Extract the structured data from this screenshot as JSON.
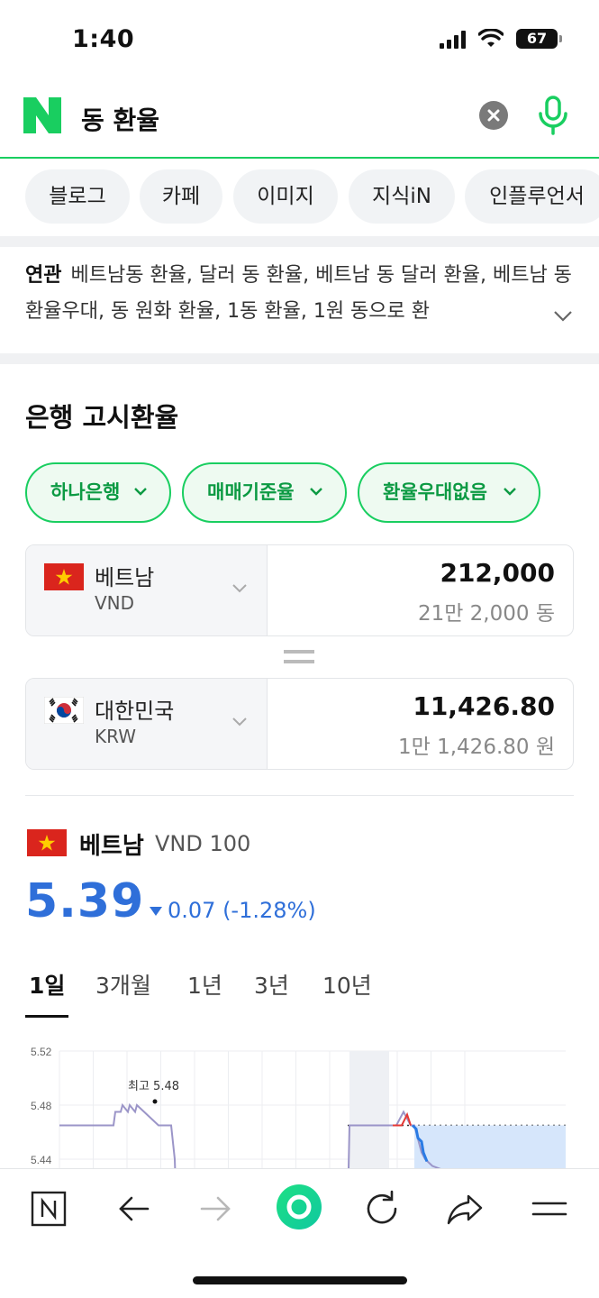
{
  "status": {
    "time": "1:40",
    "battery": "67"
  },
  "search": {
    "query": "동 환율"
  },
  "tabs": [
    "블로그",
    "카페",
    "이미지",
    "지식iN",
    "인플루언서"
  ],
  "related": {
    "label": "연관",
    "text": "베트남동 환율, 달러 동 환율, 베트남 동 달러 환율, 베트남 동 환율우대, 동 원화 환율, 1동 환율, 1원 동으로 환"
  },
  "exchange": {
    "title": "은행 고시환율",
    "filters": [
      "하나은행",
      "매매기준율",
      "환율우대없음"
    ],
    "from": {
      "country": "베트남",
      "code": "VND",
      "amount": "212,000",
      "amount_text": "21만 2,000 동"
    },
    "to": {
      "country": "대한민국",
      "code": "KRW",
      "amount": "11,426.80",
      "amount_text": "1만 1,426.80 원"
    }
  },
  "rate": {
    "country": "베트남",
    "unit": "VND 100",
    "value": "5.39",
    "change": "0.07 (-1.28%)",
    "periods": [
      "1일",
      "3개월",
      "1년",
      "3년",
      "10년"
    ],
    "active_period": "1일"
  },
  "chart_data": {
    "type": "line",
    "yticks": [
      "5.52",
      "5.48",
      "5.44"
    ],
    "ylim": [
      5.4,
      5.52
    ],
    "annotation": "최고 5.48",
    "series": [
      {
        "values": [
          5.465,
          5.465,
          5.465,
          5.465,
          5.465,
          5.475,
          5.475,
          5.48,
          5.475,
          5.48,
          5.475,
          5.48,
          5.475,
          5.465,
          5.465,
          5.44,
          5.4
        ]
      },
      {
        "values": [
          5.4,
          5.465,
          5.465,
          5.465,
          5.465,
          5.465,
          5.475,
          5.465,
          5.465,
          5.455,
          5.445,
          5.44,
          5.435,
          5.425,
          5.41
        ]
      }
    ],
    "grid": true
  },
  "colors": {
    "naver_green": "#19ce60",
    "rate_blue": "#2f6fd9",
    "chart_red": "#e53935"
  },
  "bottom_nav": [
    "naver-home-icon",
    "back-arrow-icon",
    "forward-arrow-icon",
    "green-dot-icon",
    "refresh-icon",
    "share-icon",
    "menu-icon"
  ]
}
